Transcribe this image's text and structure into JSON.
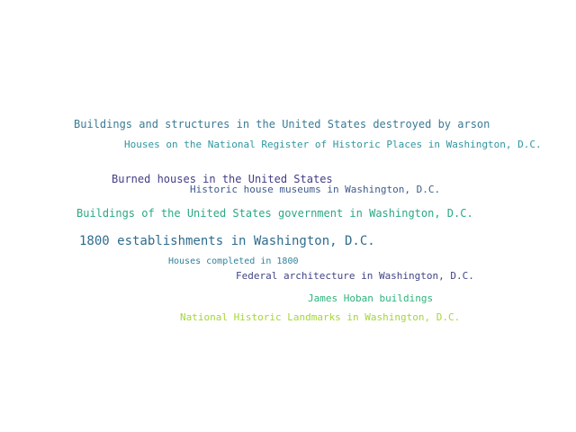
{
  "phrases": [
    {
      "text": "Buildings and structures in the United States destroyed by arson",
      "color": "#3b7b93"
    },
    {
      "text": "Houses on the National Register of Historic Places in Washington, D.C.",
      "color": "#2e96a0"
    },
    {
      "text": "Burned houses in the United States",
      "color": "#433e85"
    },
    {
      "text": "Historic house museums in Washington, D.C.",
      "color": "#3e5b8b"
    },
    {
      "text": "Buildings of the United States government in Washington, D.C.",
      "color": "#2aa883"
    },
    {
      "text": "1800 establishments in Washington, D.C.",
      "color": "#2f6c8e"
    },
    {
      "text": "Houses completed in 1800",
      "color": "#30829a"
    },
    {
      "text": "Federal architecture in Washington, D.C.",
      "color": "#414487"
    },
    {
      "text": "James Hoban buildings",
      "color": "#2fb47c"
    },
    {
      "text": "National Historic Landmarks in Washington, D.C.",
      "color": "#a5d53a"
    }
  ]
}
